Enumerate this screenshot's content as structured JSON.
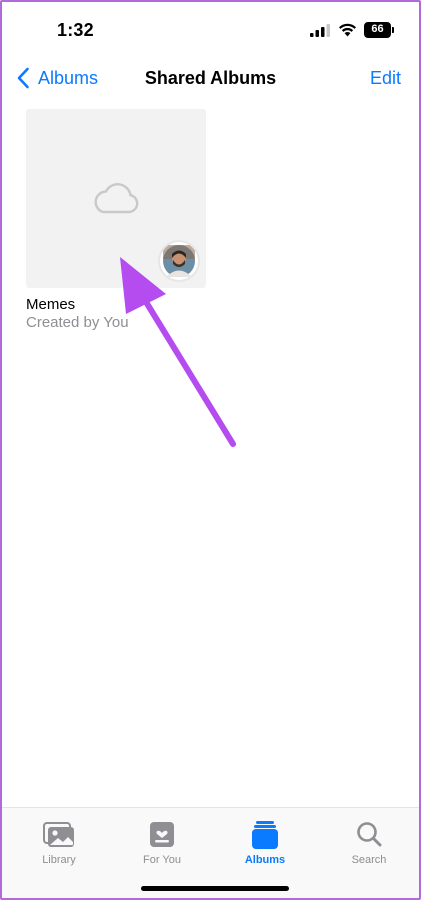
{
  "status_bar": {
    "time": "1:32",
    "battery_level": "66",
    "icons": [
      "signal-icon",
      "wifi-icon",
      "battery-icon"
    ]
  },
  "nav": {
    "back_label": "Albums",
    "title": "Shared Albums",
    "edit_label": "Edit"
  },
  "albums": [
    {
      "name": "Memes",
      "subtitle": "Created by You",
      "placeholder_icon": "cloud-icon",
      "has_avatar": true
    }
  ],
  "tabs": [
    {
      "label": "Library",
      "icon": "library-icon",
      "active": false
    },
    {
      "label": "For You",
      "icon": "for-you-icon",
      "active": false
    },
    {
      "label": "Albums",
      "icon": "albums-icon",
      "active": true
    },
    {
      "label": "Search",
      "icon": "search-icon",
      "active": false
    }
  ],
  "colors": {
    "accent": "#0a7aff",
    "inactive": "#8e8e93",
    "annotation_arrow": "#b44cf0",
    "frame_border": "#b06ad9"
  }
}
